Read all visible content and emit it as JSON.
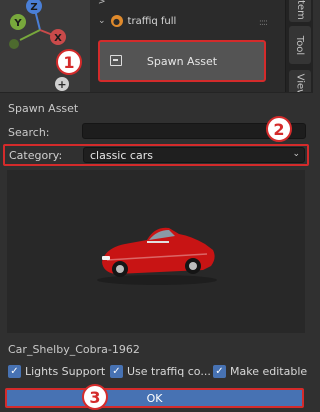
{
  "top_panel": {
    "addon_title": "traffiq full",
    "spawn_button_label": "Spawn Asset"
  },
  "vertical_tabs": [
    "Item",
    "Tool",
    "View"
  ],
  "gizmo": {
    "axis_y": "Y",
    "axis_z": "Z",
    "axis_x": "X"
  },
  "badges": [
    "1",
    "2",
    "3"
  ],
  "dialog": {
    "title": "Spawn Asset",
    "search_label": "Search:",
    "search_value": "",
    "category_label": "Category:",
    "category_value": "classic cars",
    "asset_name": "Car_Shelby_Cobra-1962",
    "options": [
      {
        "label": "Lights Support",
        "checked": true
      },
      {
        "label": "Use traffiq co...",
        "checked": true
      },
      {
        "label": "Make editable",
        "checked": true
      }
    ],
    "ok_label": "OK"
  },
  "colors": {
    "accent": "#4772b3",
    "highlight": "#d42b2b",
    "background": "#303030"
  }
}
